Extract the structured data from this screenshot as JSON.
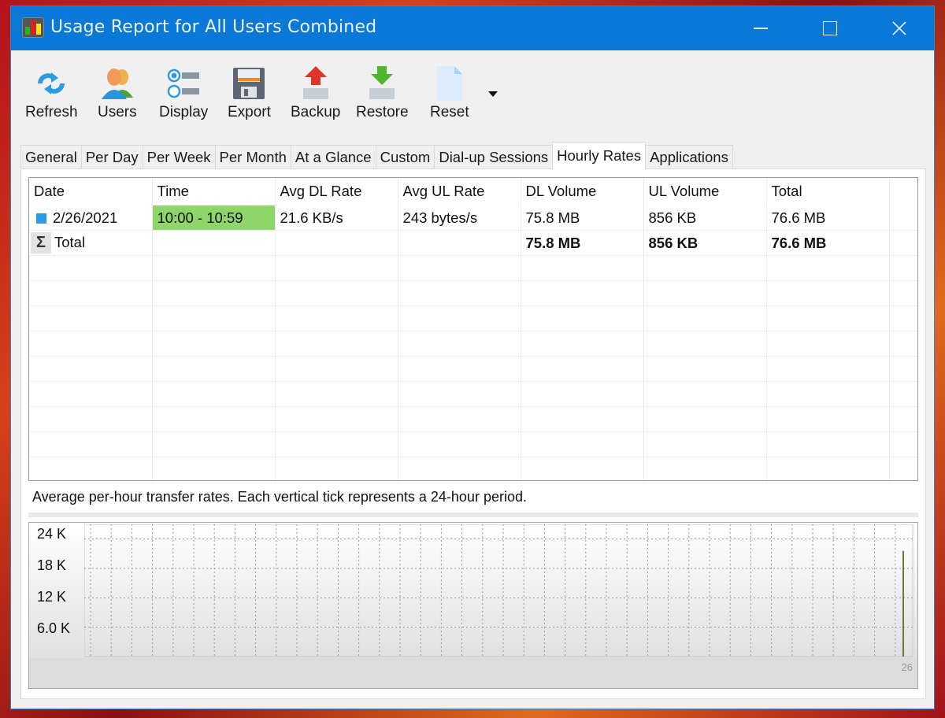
{
  "window": {
    "title": "Usage Report for All Users Combined",
    "controls": [
      "minimize",
      "maximize",
      "close"
    ]
  },
  "toolbar": {
    "buttons": [
      {
        "label": "Refresh",
        "icon": "refresh-icon"
      },
      {
        "label": "Users",
        "icon": "users-icon"
      },
      {
        "label": "Display",
        "icon": "display-options-icon"
      },
      {
        "label": "Export",
        "icon": "floppy-disk-icon"
      },
      {
        "label": "Backup",
        "icon": "upload-arrow-icon"
      },
      {
        "label": "Restore",
        "icon": "download-arrow-icon"
      },
      {
        "label": "Reset",
        "icon": "blank-document-icon"
      }
    ],
    "more_dropdown": "chevron-down-icon"
  },
  "tabs": [
    {
      "label": "General",
      "active": false
    },
    {
      "label": "Per Day",
      "active": false
    },
    {
      "label": "Per Week",
      "active": false
    },
    {
      "label": "Per Month",
      "active": false
    },
    {
      "label": "At a Glance",
      "active": false
    },
    {
      "label": "Custom",
      "active": false
    },
    {
      "label": "Dial-up Sessions",
      "active": false
    },
    {
      "label": "Hourly Rates",
      "active": true
    },
    {
      "label": "Applications",
      "active": false
    }
  ],
  "table": {
    "columns": [
      "Date",
      "Time",
      "Avg DL Rate",
      "Avg UL Rate",
      "DL Volume",
      "UL Volume",
      "Total"
    ],
    "rows": [
      {
        "date": "2/26/2021",
        "time": "10:00 - 10:59",
        "avg_dl_rate": "21.6 KB/s",
        "avg_ul_rate": "243 bytes/s",
        "dl_volume": "75.8 MB",
        "ul_volume": "856 KB",
        "total": "76.6 MB",
        "color": "#2a9be6"
      }
    ],
    "total_row": {
      "label": "Total",
      "dl_volume": "75.8 MB",
      "ul_volume": "856 KB",
      "total": "76.6 MB"
    },
    "highlight_color": "#8fd66a"
  },
  "caption": "Average per-hour transfer rates. Each vertical tick represents a 24-hour period.",
  "chart_data": {
    "type": "bar",
    "title": "",
    "xlabel": "",
    "ylabel": "",
    "y_ticks": [
      "24 K",
      "18 K",
      "12 K",
      "6.0 K"
    ],
    "y_tick_values": [
      24000,
      18000,
      12000,
      6000
    ],
    "ylim": [
      0,
      27000
    ],
    "x_end_label": "26",
    "grid": true,
    "series": [
      {
        "name": "Avg DL Rate",
        "color": "#6b7a3a",
        "points": [
          {
            "x": "2/26/2021 10:00",
            "y": 21600
          }
        ]
      }
    ]
  }
}
